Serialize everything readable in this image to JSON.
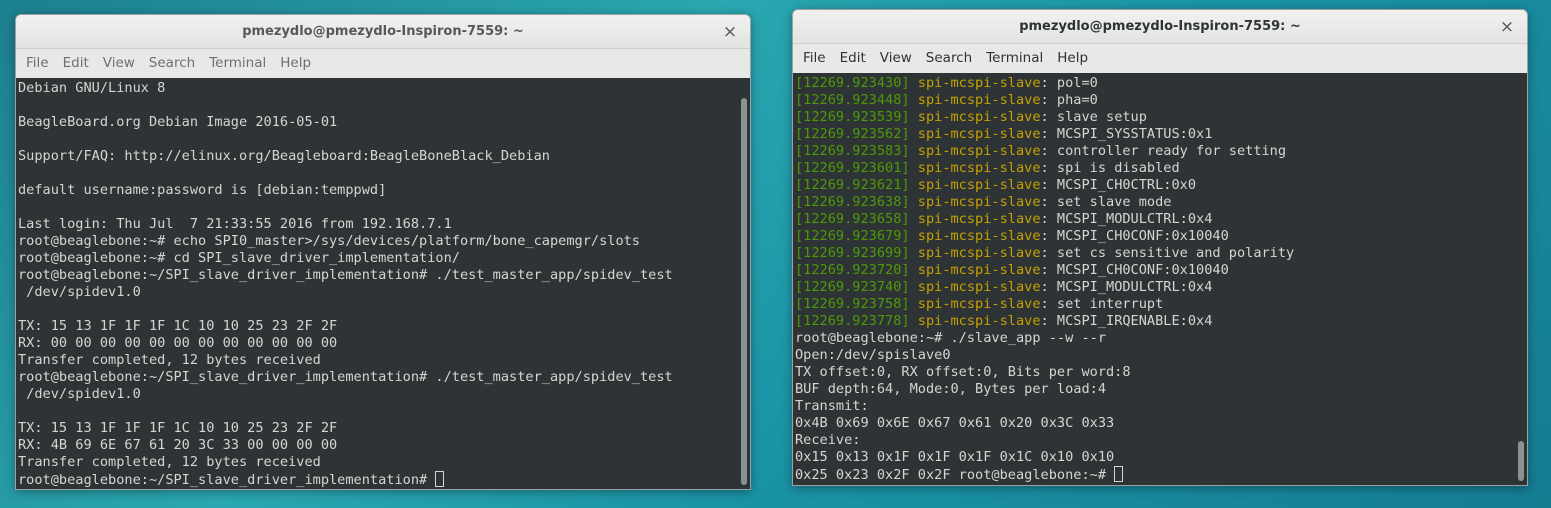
{
  "left_window": {
    "title": "pmezydlo@pmezydlo-Inspiron-7559: ~",
    "close_glyph": "×",
    "menu": [
      "File",
      "Edit",
      "View",
      "Search",
      "Terminal",
      "Help"
    ],
    "lines": [
      "Debian GNU/Linux 8",
      "",
      "BeagleBoard.org Debian Image 2016-05-01",
      "",
      "Support/FAQ: http://elinux.org/Beagleboard:BeagleBoneBlack_Debian",
      "",
      "default username:password is [debian:temppwd]",
      "",
      "Last login: Thu Jul  7 21:33:55 2016 from 192.168.7.1",
      "root@beaglebone:~# echo SPI0_master>/sys/devices/platform/bone_capemgr/slots",
      "root@beaglebone:~# cd SPI_slave_driver_implementation/",
      "root@beaglebone:~/SPI_slave_driver_implementation# ./test_master_app/spidev_test",
      " /dev/spidev1.0",
      "",
      "TX: 15 13 1F 1F 1F 1C 10 10 25 23 2F 2F",
      "RX: 00 00 00 00 00 00 00 00 00 00 00 00",
      "Transfer completed, 12 bytes received",
      "root@beaglebone:~/SPI_slave_driver_implementation# ./test_master_app/spidev_test",
      " /dev/spidev1.0",
      "",
      "TX: 15 13 1F 1F 1F 1C 10 10 25 23 2F 2F",
      "RX: 4B 69 6E 67 61 20 3C 33 00 00 00 00",
      "Transfer completed, 12 bytes received"
    ],
    "prompt": "root@beaglebone:~/SPI_slave_driver_implementation# "
  },
  "right_window": {
    "title": "pmezydlo@pmezydlo-Inspiron-7559: ~",
    "close_glyph": "×",
    "menu": [
      "File",
      "Edit",
      "View",
      "Search",
      "Terminal",
      "Help"
    ],
    "log_lines": [
      {
        "ts": "[12269.923430]",
        "mod": "spi-mcspi-slave",
        "msg": ": pol=0"
      },
      {
        "ts": "[12269.923448]",
        "mod": "spi-mcspi-slave",
        "msg": ": pha=0"
      },
      {
        "ts": "[12269.923539]",
        "mod": "spi-mcspi-slave",
        "msg": ": slave setup"
      },
      {
        "ts": "[12269.923562]",
        "mod": "spi-mcspi-slave",
        "msg": ": MCSPI_SYSSTATUS:0x1"
      },
      {
        "ts": "[12269.923583]",
        "mod": "spi-mcspi-slave",
        "msg": ": controller ready for setting"
      },
      {
        "ts": "[12269.923601]",
        "mod": "spi-mcspi-slave",
        "msg": ": spi is disabled"
      },
      {
        "ts": "[12269.923621]",
        "mod": "spi-mcspi-slave",
        "msg": ": MCSPI_CH0CTRL:0x0"
      },
      {
        "ts": "[12269.923638]",
        "mod": "spi-mcspi-slave",
        "msg": ": set slave mode"
      },
      {
        "ts": "[12269.923658]",
        "mod": "spi-mcspi-slave",
        "msg": ": MCSPI_MODULCTRL:0x4"
      },
      {
        "ts": "[12269.923679]",
        "mod": "spi-mcspi-slave",
        "msg": ": MCSPI_CH0CONF:0x10040"
      },
      {
        "ts": "[12269.923699]",
        "mod": "spi-mcspi-slave",
        "msg": ": set cs sensitive and polarity"
      },
      {
        "ts": "[12269.923720]",
        "mod": "spi-mcspi-slave",
        "msg": ": MCSPI_CH0CONF:0x10040"
      },
      {
        "ts": "[12269.923740]",
        "mod": "spi-mcspi-slave",
        "msg": ": MCSPI_MODULCTRL:0x4"
      },
      {
        "ts": "[12269.923758]",
        "mod": "spi-mcspi-slave",
        "msg": ": set interrupt"
      },
      {
        "ts": "[12269.923778]",
        "mod": "spi-mcspi-slave",
        "msg": ": MCSPI_IRQENABLE:0x4"
      }
    ],
    "lines": [
      "root@beaglebone:~# ./slave_app --w --r",
      "Open:/dev/spislave0",
      "TX offset:0, RX offset:0, Bits per word:8",
      "BUF depth:64, Mode:0, Bytes per load:4",
      "Transmit:",
      "0x4B 0x69 0x6E 0x67 0x61 0x20 0x3C 0x33",
      "Receive:",
      "0x15 0x13 0x1F 0x1F 0x1F 0x1C 0x10 0x10"
    ],
    "prompt": "0x25 0x23 0x2F 0x2F root@beaglebone:~# "
  },
  "colors": {
    "terminal_bg": "#2e3436",
    "terminal_fg": "#d3d7cf",
    "timestamp": "#4e9a06",
    "module": "#c4a000"
  }
}
